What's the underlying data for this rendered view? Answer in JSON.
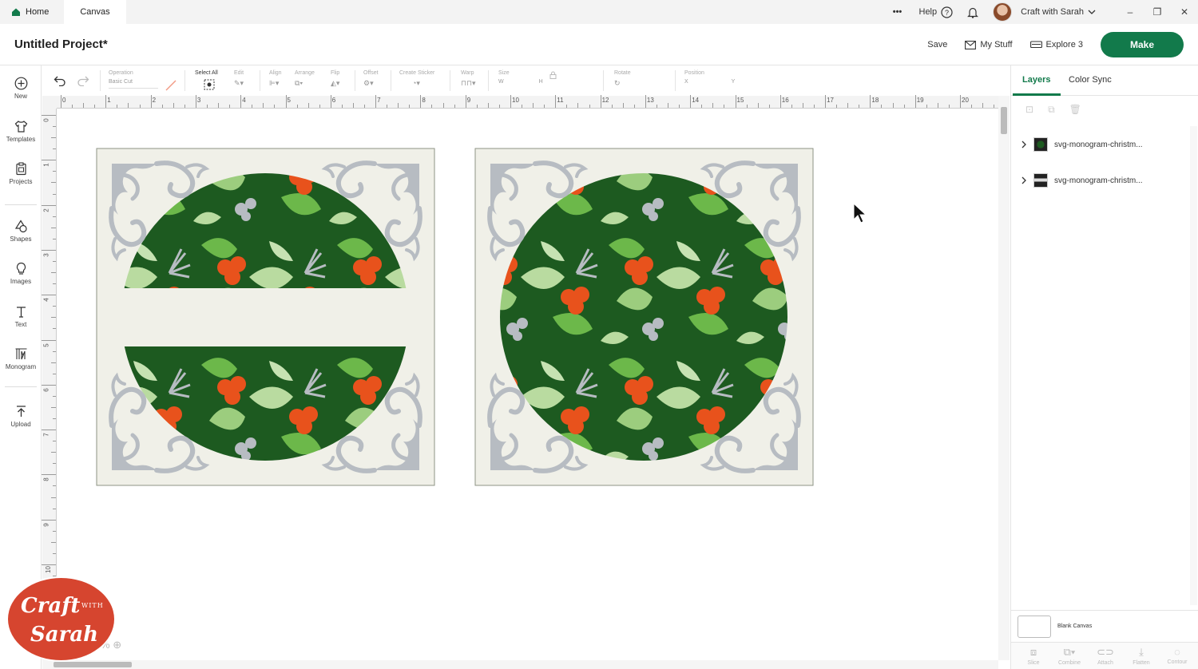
{
  "titlebar": {
    "tab_home": "Home",
    "tab_canvas": "Canvas",
    "help": "Help",
    "account": "Craft with Sarah",
    "more": "•••"
  },
  "header": {
    "project_title": "Untitled Project*",
    "save": "Save",
    "my_stuff": "My Stuff",
    "machine": "Explore 3",
    "make": "Make"
  },
  "leftnav": [
    {
      "label": "New",
      "icon": "plus-circle-icon"
    },
    {
      "label": "Templates",
      "icon": "shirt-icon"
    },
    {
      "label": "Projects",
      "icon": "clipboard-icon"
    },
    {
      "label": "Shapes",
      "icon": "shapes-icon"
    },
    {
      "label": "Images",
      "icon": "lightbulb-icon"
    },
    {
      "label": "Text",
      "icon": "text-icon"
    },
    {
      "label": "Monogram",
      "icon": "monogram-icon"
    },
    {
      "label": "Upload",
      "icon": "upload-icon"
    }
  ],
  "toolbar": {
    "operation_label": "Operation",
    "operation_value": "Basic Cut",
    "select_all": "Select All",
    "edit": "Edit",
    "align": "Align",
    "arrange": "Arrange",
    "flip": "Flip",
    "offset": "Offset",
    "create_sticker": "Create Sticker",
    "warp": "Warp",
    "size": "Size",
    "size_w": "W",
    "size_h": "H",
    "rotate": "Rotate",
    "position": "Position",
    "pos_x": "X",
    "pos_y": "Y"
  },
  "ruler": {
    "h": [
      "0",
      "1",
      "2",
      "3",
      "4",
      "5",
      "6",
      "7",
      "8",
      "9",
      "10",
      "11",
      "12",
      "13",
      "14",
      "15",
      "16",
      "17",
      "18",
      "19",
      "20"
    ],
    "v": [
      "0",
      "1",
      "2",
      "3",
      "4",
      "5",
      "6",
      "7",
      "8",
      "9",
      "10"
    ]
  },
  "rightpanel": {
    "tab_layers": "Layers",
    "tab_color_sync": "Color Sync",
    "layers": [
      {
        "name": "svg-monogram-christm..."
      },
      {
        "name": "svg-monogram-christm..."
      }
    ],
    "blank_canvas": "Blank Canvas",
    "bottom_tools": [
      "Slice",
      "Combine",
      "Attach",
      "Flatten",
      "Contour"
    ]
  },
  "logo": {
    "line1": "Craft",
    "line2": "WITH",
    "line3": "Sarah"
  },
  "zoom": "%",
  "colors": {
    "brand_green": "#127a4b",
    "card_bg": "#f0f0e8",
    "flourish": "#b7bcc2",
    "dark_green": "#1d5a20",
    "berry": "#e8521c",
    "logo_red": "#d6452f"
  }
}
